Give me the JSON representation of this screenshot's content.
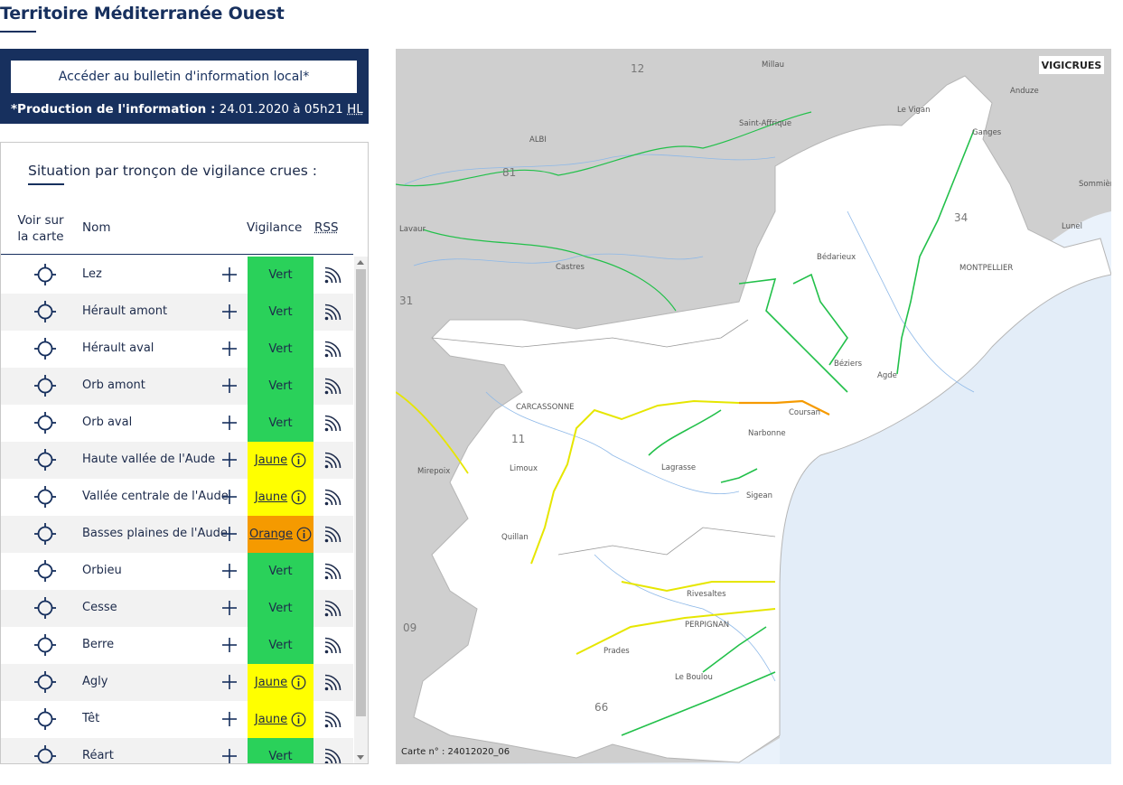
{
  "header": {
    "title": "Territoire Méditerranée Ouest"
  },
  "info_box": {
    "bulletin_button_label": "Accéder au bulletin d'information local*",
    "production_label": "*Production de l'information :",
    "production_value": "24.01.2020 à 05h21",
    "production_tz": "HL"
  },
  "panel": {
    "title": "Situation par tronçon de vigilance crues :",
    "columns": {
      "voir_sur_la_carte": "Voir sur la carte",
      "nom": "Nom",
      "vigilance": "Vigilance",
      "rss": "RSS"
    },
    "rows": [
      {
        "name": "Lez",
        "level": "Vert"
      },
      {
        "name": "Hérault amont",
        "level": "Vert"
      },
      {
        "name": "Hérault aval",
        "level": "Vert"
      },
      {
        "name": "Orb amont",
        "level": "Vert"
      },
      {
        "name": "Orb aval",
        "level": "Vert"
      },
      {
        "name": "Haute vallée de l'Aude",
        "level": "Jaune"
      },
      {
        "name": "Vallée centrale de l'Aude",
        "level": "Jaune"
      },
      {
        "name": "Basses plaines de l'Aude",
        "level": "Orange"
      },
      {
        "name": "Orbieu",
        "level": "Vert"
      },
      {
        "name": "Cesse",
        "level": "Vert"
      },
      {
        "name": "Berre",
        "level": "Vert"
      },
      {
        "name": "Agly",
        "level": "Jaune"
      },
      {
        "name": "Têt",
        "level": "Jaune"
      },
      {
        "name": "Réart",
        "level": "Vert"
      }
    ],
    "level_colors": {
      "Vert": "#2ad15a",
      "Jaune": "#ffff00",
      "Orange": "#f59a00"
    }
  },
  "map": {
    "logo": "VIGICRUES",
    "map_number": "Carte n° : 24012020_06",
    "departments": [
      "12",
      "81",
      "34",
      "31",
      "11",
      "09",
      "66"
    ],
    "cities": [
      "Millau",
      "Anduze",
      "Le Vigan",
      "Saint-Affrique",
      "ALBI",
      "Ganges",
      "Sommières",
      "Lavaur",
      "Lunel",
      "Castres",
      "Bédarieux",
      "MONTPELLIER",
      "Béziers",
      "Agde",
      "CARCASSONNE",
      "Coursan",
      "Narbonne",
      "Mirepoix",
      "Limoux",
      "Lagrasse",
      "Sigean",
      "Quillan",
      "Rivesaltes",
      "PERPIGNAN",
      "Prades",
      "Le Boulou"
    ],
    "icons": {
      "target": "crosshair-target-icon",
      "plus": "plus-icon",
      "rss": "rss-feed-icon",
      "info": "info-circle-icon"
    }
  }
}
